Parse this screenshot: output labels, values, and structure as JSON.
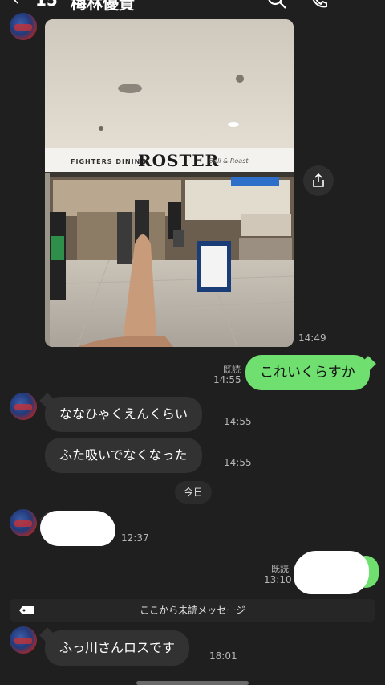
{
  "header": {
    "back_icon": "chevron-left-icon",
    "unread_count": "15",
    "contact_name": "梅林優貴",
    "icons": [
      "search-icon",
      "phone-icon",
      "menu-icon"
    ]
  },
  "messages": {
    "photo": {
      "time": "14:49",
      "store_sign": "ROSTER",
      "store_sub": "FIGHTERS DINING",
      "store_script": "Deli & Roast"
    },
    "sent1": {
      "read": "既読",
      "time": "14:55",
      "text": "これいくらすか"
    },
    "recv1": {
      "text": "ななひゃくえんくらい",
      "time": "14:55"
    },
    "recv2": {
      "text": "ふた吸いでなくなった",
      "time": "14:55"
    },
    "day_divider": "今日",
    "recv3": {
      "time": "12:37"
    },
    "sent2": {
      "read": "既読",
      "time": "13:10"
    },
    "unread_divider": "ここから未読メッセージ",
    "recv4": {
      "text": "ふっ川さんロスです",
      "time": "18:01"
    }
  },
  "colors": {
    "background": "#1f1f1f",
    "incoming_bubble": "#323232",
    "outgoing_bubble": "#6fe070"
  }
}
